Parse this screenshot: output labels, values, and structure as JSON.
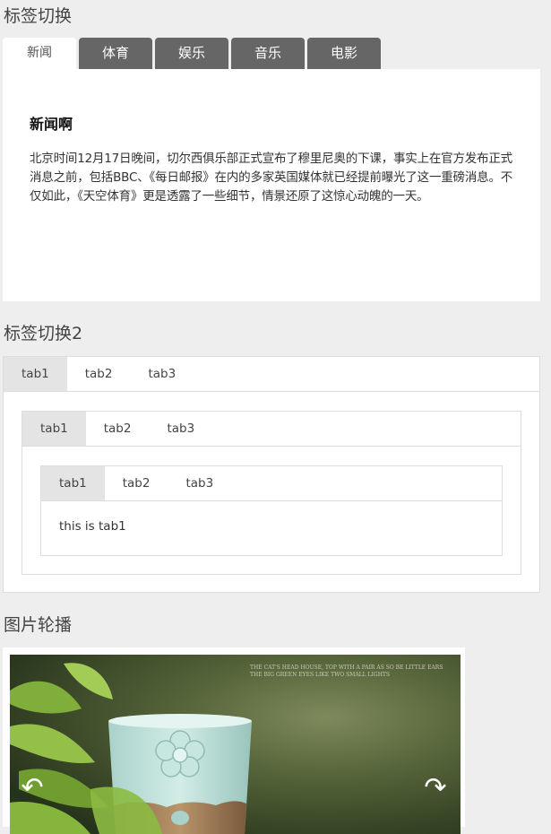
{
  "section1": {
    "title": "标签切换",
    "tabs": [
      {
        "label": "新闻",
        "active": true
      },
      {
        "label": "体育",
        "active": false
      },
      {
        "label": "娱乐",
        "active": false
      },
      {
        "label": "音乐",
        "active": false
      },
      {
        "label": "电影",
        "active": false
      }
    ],
    "panel": {
      "heading": "新闻啊",
      "body": "北京时间12月17日晚间，切尔西俱乐部正式宣布了穆里尼奥的下课，事实上在官方发布正式消息之前，包括BBC、《每日邮报》在内的多家英国媒体就已经提前曝光了这一重磅消息。不仅如此，《天空体育》更是透露了一些细节，情景还原了这惊心动魄的一天。"
    }
  },
  "section2": {
    "title": "标签切换2",
    "outer_tabs": [
      "tab1",
      "tab2",
      "tab3"
    ],
    "middle_tabs": [
      "tab1",
      "tab2",
      "tab3"
    ],
    "inner_tabs": [
      "tab1",
      "tab2",
      "tab3"
    ],
    "inner_content": "this is tab1"
  },
  "section3": {
    "title": "图片轮播",
    "prev_icon": "curved-arrow-left-icon",
    "next_icon": "curved-arrow-right-icon",
    "prev_glyph": "↶",
    "next_glyph": "↷",
    "slide_caption": "THE CAT'S HEAD HOUSE, TOP WITH A PAIR AS SO BE LITTLE EARS",
    "slide_caption2": "THE BIG GREEN EYES LIKE TWO SMALL LIGHTS"
  }
}
